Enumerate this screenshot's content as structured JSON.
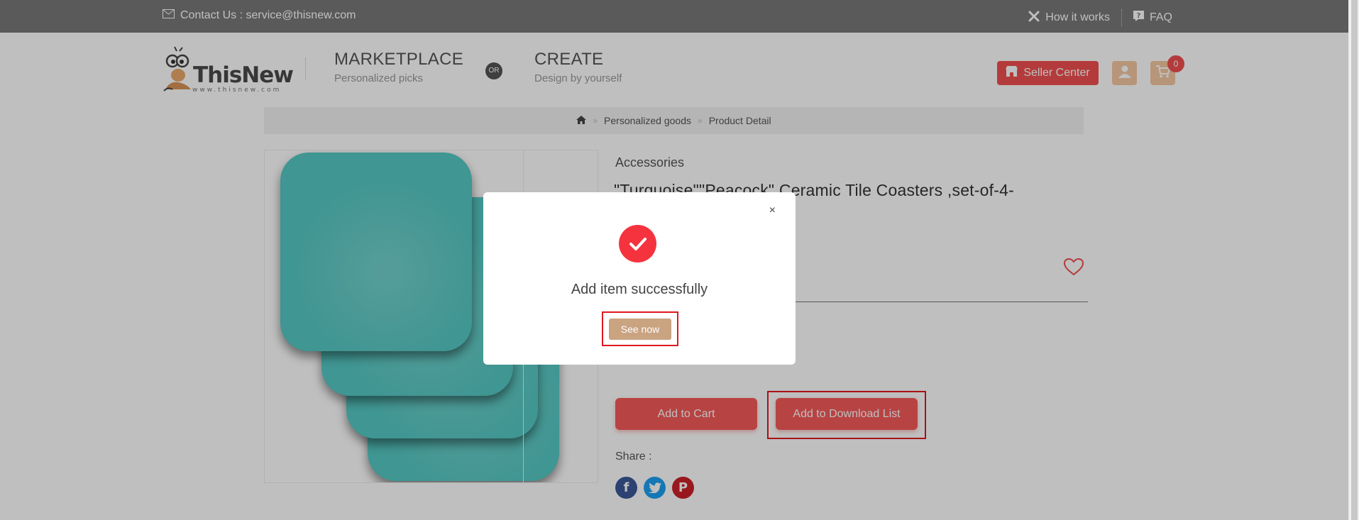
{
  "topbar": {
    "contact": "Contact Us : service@thisnew.com",
    "how_it_works": "How it works",
    "faq": "FAQ"
  },
  "header": {
    "logo_name": "ThisNew",
    "logo_sub": "www.thisnew.com",
    "marketplace_title": "MARKETPLACE",
    "marketplace_sub": "Personalized picks",
    "or_label": "OR",
    "create_title": "CREATE",
    "create_sub": "Design by yourself",
    "seller_center": "Seller Center",
    "cart_count": "0"
  },
  "breadcrumb": {
    "items": [
      "Personalized goods",
      "Product Detail"
    ]
  },
  "product": {
    "category": "Accessories",
    "title": "\"Turquoise\"\"Peacock\" Ceramic Tile Coasters ,set-of-4-",
    "add_to_cart": "Add to Cart",
    "add_to_download": "Add to Download List",
    "share_label": "Share :"
  },
  "modal": {
    "message": "Add item successfully",
    "see_now": "See now",
    "close": "×"
  },
  "colors": {
    "accent": "#f04f4f",
    "topbar": "#787878",
    "see_now": "#caa381",
    "success": "#f5333e",
    "facebook": "#3b5998",
    "twitter": "#1da1f2",
    "pinterest": "#cb2027"
  }
}
